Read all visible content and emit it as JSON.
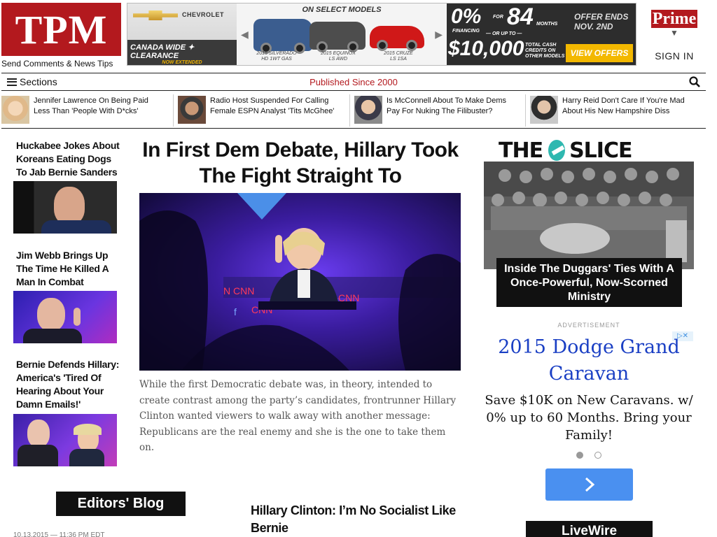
{
  "header": {
    "logo_text": "TPM",
    "tips_link": "Send Comments & News Tips",
    "prime_label": "Prime",
    "signin_label": "SIGN IN"
  },
  "ad_banner": {
    "brand": "CHEVROLET",
    "campaign_line1": "CANADA WIDE ✦ CLEARANCE",
    "campaign_line2": "NOW EXTENDED",
    "on_select": "ON SELECT MODELS",
    "models": [
      {
        "line1": "2015 SILVERADO",
        "line2": "HD 1WT GAS"
      },
      {
        "line1": "2015 EQUINOX",
        "line2": "LS AWD"
      },
      {
        "line1": "2015 CRUZE",
        "line2": "LS 1SA"
      }
    ],
    "rate": "0%",
    "financing": "FINANCING",
    "for_label": "FOR",
    "months_value": "84",
    "months_label": "MONTHS",
    "or_up_to": "— OR UP TO —",
    "cash_value": "$10,000",
    "cash_fine": "TOTAL CASH CREDITS ON OTHER MODELS",
    "offer_ends": "OFFER ENDS NOV. 2ND",
    "cta": "VIEW OFFERS",
    "colors": {
      "truck": "#3b5d8f",
      "suv": "#555555",
      "car": "#d01818",
      "cta_bg": "#f3b800"
    }
  },
  "nav": {
    "sections_label": "Sections",
    "tagline": "Published Since 2000",
    "search_icon": "search-icon"
  },
  "strip": [
    {
      "text": "Jennifer Lawrence On Being Paid Less Than 'People With D*cks'"
    },
    {
      "text": "Radio Host Suspended For Calling Female ESPN Analyst 'Tits McGhee'"
    },
    {
      "text": "Is McConnell About To Make Dems Pay For Nuking The Filibuster?"
    },
    {
      "text": "Harry Reid Don't Care If You're Mad About His New Hampshire Diss"
    }
  ],
  "left_col": [
    {
      "title": "Huckabee Jokes About Koreans Eating Dogs To Jab Bernie Sanders"
    },
    {
      "title": "Jim Webb Brings Up The Time He Killed A Man In Combat"
    },
    {
      "title": "Bernie Defends Hillary: America's 'Tired Of Hearing About Your Damn Emails!'"
    }
  ],
  "main": {
    "headline": "In First Dem Debate, Hillary Took The Fight Straight To Republicans",
    "summary": "While the first Democratic debate was, in theory, intended to create contrast among the party’s candidates, frontrunner Hillary Clinton wanted viewers to walk away with another message: Republicans are the real enemy and she is the one to take them on."
  },
  "slice": {
    "brand_left": "THE",
    "brand_right": "SLICE",
    "caption": "Inside The Duggars' Ties With A Once-Powerful, Now-Scorned Ministry"
  },
  "right_ad": {
    "label": "ADVERTISEMENT",
    "title": "2015 Dodge Grand Caravan",
    "body": "Save $10K on New Caravans. w/ 0% up to 60 Months. Bring your Family!",
    "cta_icon": "chevron-right-icon"
  },
  "bottom": {
    "editors_blog": "Editors' Blog",
    "date": "10.13.2015 — 11:36 PM EDT",
    "second_headline": "Hillary Clinton: I’m No Socialist Like Bernie",
    "livewire": "LiveWire"
  }
}
